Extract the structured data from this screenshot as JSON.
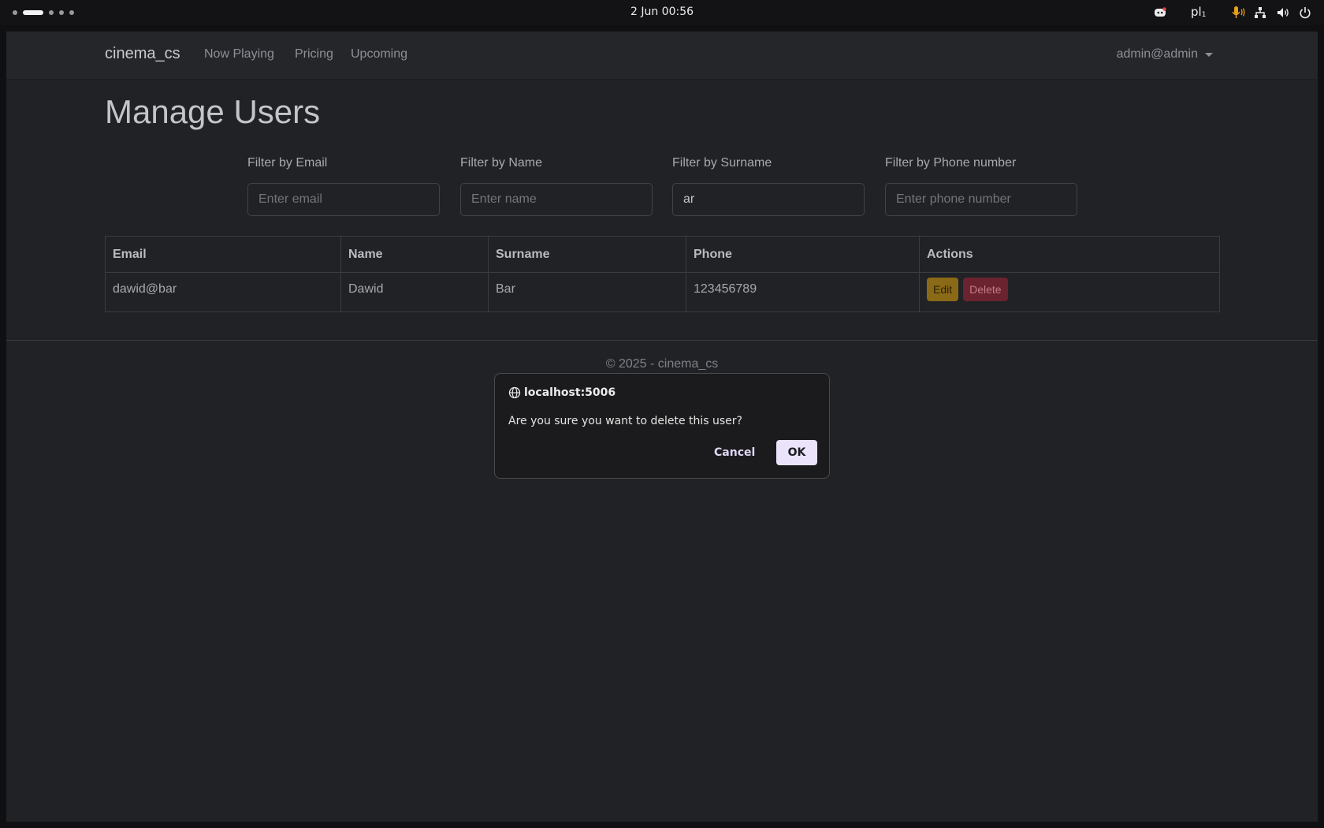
{
  "system": {
    "clock": "2 Jun  00:56",
    "language": "pl",
    "language_sub": "1",
    "icons": [
      "discord-icon",
      "microphone-icon",
      "network-icon",
      "volume-icon",
      "power-icon"
    ]
  },
  "navbar": {
    "brand": "cinema_cs",
    "links": [
      "Now Playing",
      "Pricing",
      "Upcoming"
    ],
    "user": "admin@admin"
  },
  "page": {
    "title": "Manage Users"
  },
  "filters": [
    {
      "label": "Filter by Email",
      "placeholder": "Enter email",
      "value": ""
    },
    {
      "label": "Filter by Name",
      "placeholder": "Enter name",
      "value": ""
    },
    {
      "label": "Filter by Surname",
      "placeholder": "",
      "value": "ar"
    },
    {
      "label": "Filter by Phone number",
      "placeholder": "Enter phone number",
      "value": ""
    }
  ],
  "table": {
    "headers": [
      "Email",
      "Name",
      "Surname",
      "Phone",
      "Actions"
    ],
    "rows": [
      {
        "email": "dawid@bar",
        "name": "Dawid",
        "surname": "Bar",
        "phone": "123456789",
        "edit": "Edit",
        "delete": "Delete"
      }
    ]
  },
  "footer": {
    "text": "© 2025 - cinema_cs"
  },
  "dialog": {
    "origin": "localhost:5006",
    "message": "Are you sure you want to delete this user?",
    "cancel": "Cancel",
    "ok": "OK"
  },
  "colors": {
    "accent_edit": "#8a6a16",
    "accent_delete": "#6b2330",
    "mic_active": "#e8a01c"
  }
}
